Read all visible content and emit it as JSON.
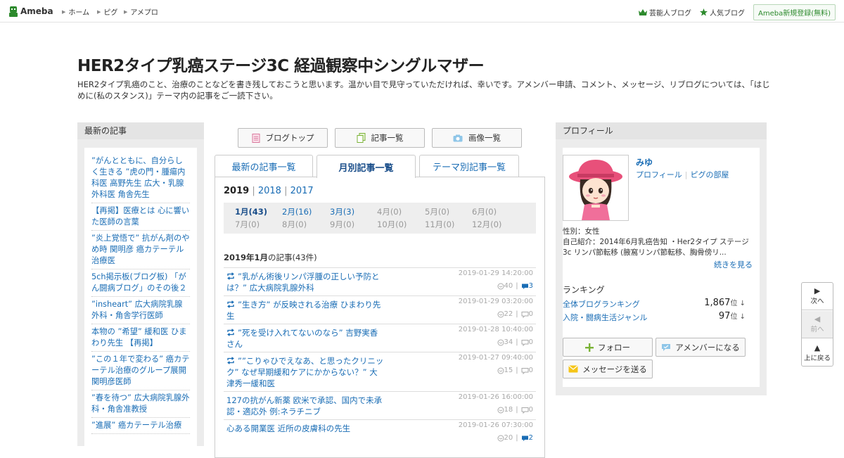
{
  "topbar": {
    "logo": "Ameba",
    "nav": [
      "ホーム",
      "ピグ",
      "アメプロ"
    ],
    "right_links": [
      "芸能人ブログ",
      "人気ブログ"
    ],
    "signup": "Ameba新規登録(無料)"
  },
  "header": {
    "title": "HER2タイプ乳癌ステージ3C 経過観察中シングルマザー",
    "description": "HER2タイプ乳癌のこと、治療のことなどを書き残しておこうと思います。温かい目で見守っていただければ、幸いです。アメンバー申請、コメント、メッセージ、リブログについては、「はじめに(私のスタンス)」テーマ内の記事をご一読下さい。"
  },
  "left_sidebar": {
    "heading": "最新の記事",
    "items": [
      "”がんとともに、自分らしく生きる ”虎の門・腫瘍内科医 高野先生 広大・乳腺外科医 角舎先生",
      "【再掲】医療とは 心に響いた医師の言葉",
      "”炎上覚悟で” 抗がん剤のやめ時 関明彦 癌カテーテル治療医",
      "5ch掲示板(ブログ板) 「がん闘病ブログ」のその後２",
      "”insheart” 広大病院乳腺外科・角舎学行医師",
      "本物の ”希望” 緩和医 ひまわり先生 【再掲】",
      "”この１年で変わる” 癌カテーテル治療のグループ展開 関明彦医師",
      "”春を待つ” 広大病院乳腺外科・角舎准教授",
      "”進展” 癌カテーテル治療"
    ]
  },
  "center": {
    "buttons": [
      "ブログトップ",
      "記事一覧",
      "画像一覧"
    ],
    "tabs": [
      "最新の記事一覧",
      "月別記事一覧",
      "テーマ別記事一覧"
    ],
    "years": [
      "2019",
      "2018",
      "2017"
    ],
    "months": [
      "1月(43)",
      "2月(16)",
      "3月(3)",
      "4月(0)",
      "5月(0)",
      "6月(0)",
      "7月(0)",
      "8月(0)",
      "9月(0)",
      "10月(0)",
      "11月(0)",
      "12月(0)"
    ],
    "month_heading": "2019年1月",
    "month_heading_count": "の記事(43件)",
    "entries": [
      {
        "title": "”乳がん術後リンパ浮腫の正しい予防とは？” 広大病院乳腺外科",
        "date": "2019-01-29 14:20:00",
        "likes": "40",
        "comments": "3",
        "reblog": true
      },
      {
        "title": "”生き方” が反映される治療 ひまわり先生",
        "date": "2019-01-29 03:20:00",
        "likes": "22",
        "comments": "0",
        "reblog": true
      },
      {
        "title": "”死を受け入れてないのなら” 吉野実香さん",
        "date": "2019-01-28 10:40:00",
        "likes": "34",
        "comments": "0",
        "reblog": true
      },
      {
        "title": "””こりゃひでえなあ、と思ったクリニック” なぜ早期緩和ケアにかからない？” 大津秀一緩和医",
        "date": "2019-01-27 09:40:00",
        "likes": "15",
        "comments": "0",
        "reblog": true
      },
      {
        "title": "127の抗がん新薬 欧米で承認、国内で未承認・適応外 例:ネラチニブ",
        "date": "2019-01-26 16:00:00",
        "likes": "18",
        "comments": "0",
        "reblog": false
      },
      {
        "title": "心ある開業医 近所の皮膚科の先生",
        "date": "2019-01-26 07:30:00",
        "likes": "20",
        "comments": "2",
        "reblog": false
      }
    ]
  },
  "profile": {
    "heading": "プロフィール",
    "name": "みゆ",
    "link_profile": "プロフィール",
    "link_pig": "ピグの部屋",
    "gender": "性別：女性",
    "intro": "自己紹介：2014年6月乳癌告知 ・Her2タイプ ステージ3c リンパ節転移 (腋窩リンパ節転移、胸骨傍リ...",
    "more": "続きを見る",
    "ranking_heading": "ランキング",
    "rankings": [
      {
        "label": "全体ブログランキング",
        "value": "1,867",
        "unit": "位 ↓"
      },
      {
        "label": "入院・闘病生活ジャンル",
        "value": "97",
        "unit": "位 ↓"
      }
    ],
    "buttons": {
      "follow": "フォロー",
      "amember": "アメンバーになる",
      "message": "メッセージを送る"
    }
  },
  "side_nav": {
    "next": "次へ",
    "prev": "前へ",
    "top": "上に戻る"
  },
  "colors": {
    "link": "#1a6db5",
    "brand_green": "#2d8a2d",
    "sidebar_bg": "#ececec"
  }
}
